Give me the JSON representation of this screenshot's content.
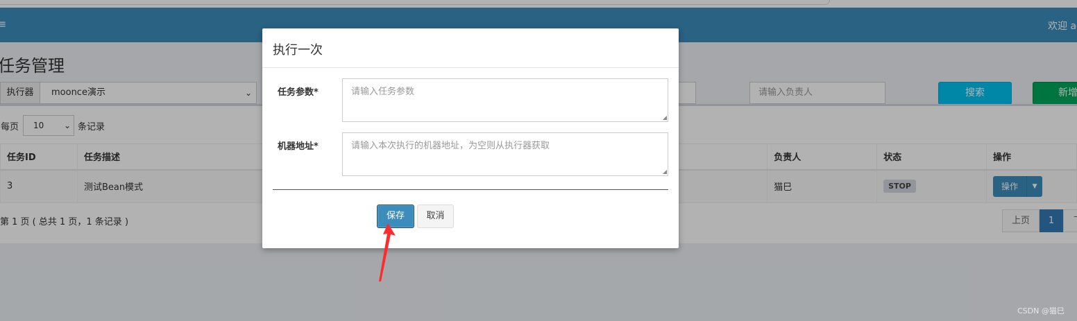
{
  "header": {
    "menu_icon": "hamburger-menu-icon",
    "welcome": "欢迎 ad"
  },
  "page": {
    "title": "任务管理"
  },
  "filters": {
    "executor_label": "执行器",
    "executor_value": "moonce演示",
    "owner_placeholder": "请输入负责人",
    "search_label": "搜索",
    "add_label": "新增"
  },
  "table_controls": {
    "per_page_prefix": "每页",
    "per_page_value": "10",
    "per_page_suffix": "条记录"
  },
  "table": {
    "headers": [
      "任务ID",
      "任务描述",
      "负责人",
      "状态",
      "操作"
    ],
    "rows": [
      {
        "id": "3",
        "desc": "测试Bean模式",
        "owner": "猫巳",
        "status": "STOP",
        "action": "操作"
      }
    ]
  },
  "pagination": {
    "info": "第 1 页 ( 总共 1 页，1 条记录 )",
    "prev": "上页",
    "current": "1",
    "next": "下"
  },
  "modal": {
    "title": "执行一次",
    "fields": [
      {
        "label": "任务参数*",
        "placeholder": "请输入任务参数"
      },
      {
        "label": "机器地址*",
        "placeholder": "请输入本次执行的机器地址，为空则从执行器获取"
      }
    ],
    "save": "保存",
    "cancel": "取消"
  },
  "annotation": {
    "color": "#ff2b2b"
  },
  "watermark": "CSDN @猫巳",
  "colors": {
    "primary": "#3c8dbc",
    "info": "#00c0ef",
    "success": "#00a65a"
  }
}
